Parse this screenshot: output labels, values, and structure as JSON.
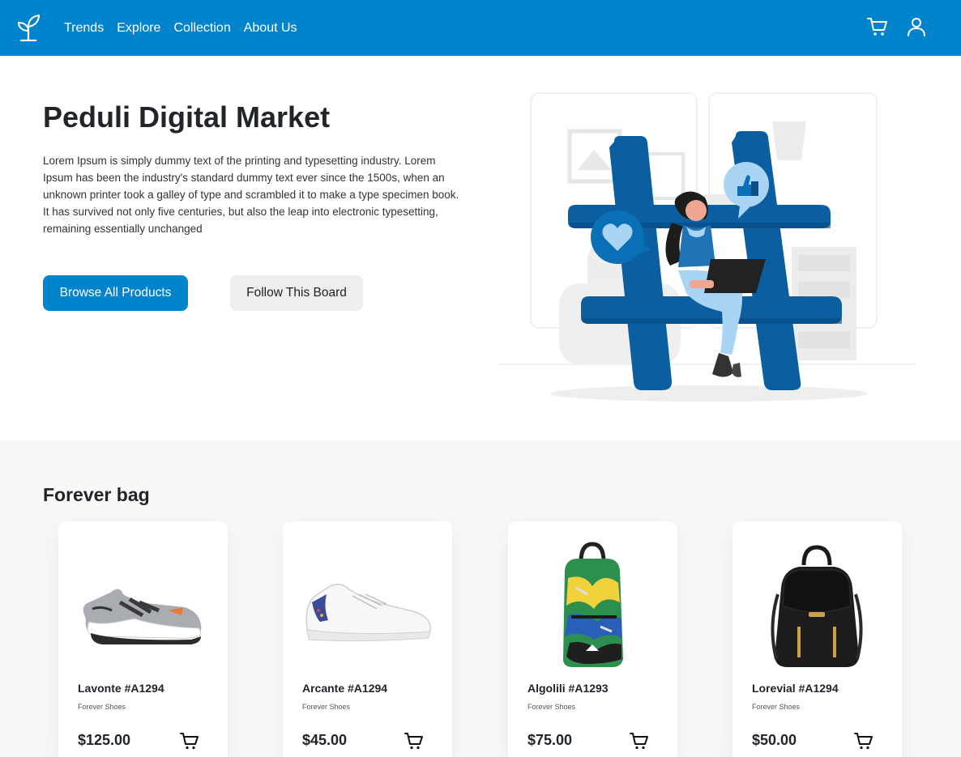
{
  "nav": {
    "links": [
      "Trends",
      "Explore",
      "Collection",
      "About Us"
    ],
    "brand_icon": "sprout-icon",
    "cart_icon": "cart-icon",
    "user_icon": "user-icon"
  },
  "hero": {
    "title": "Peduli Digital Market",
    "description": "Lorem Ipsum is simply dummy text of the printing and typesetting industry. Lorem Ipsum has been the industry's standard dummy text ever since the 1500s, when an unknown printer took a galley of type and scrambled it to make a type specimen book. It has survived not only five centuries, but also the leap into electronic typesetting, remaining essentially unchanged",
    "primary_button": "Browse All Products",
    "secondary_button": "Follow This Board"
  },
  "section": {
    "title": "Forever bag"
  },
  "products": [
    {
      "name": "Lavonte #A1294",
      "category": "Forever Shoes",
      "price": "$125.00"
    },
    {
      "name": "Arcante #A1294",
      "category": "Forever Shoes",
      "price": "$45.00"
    },
    {
      "name": "Algolili #A1293",
      "category": "Forever Shoes",
      "price": "$75.00"
    },
    {
      "name": "Lorevial #A1294",
      "category": "Forever Shoes",
      "price": "$50.00"
    }
  ],
  "colors": {
    "primary": "#0284cd",
    "hashtag": "#0b5fa0",
    "background_section": "#f8f8f8"
  }
}
